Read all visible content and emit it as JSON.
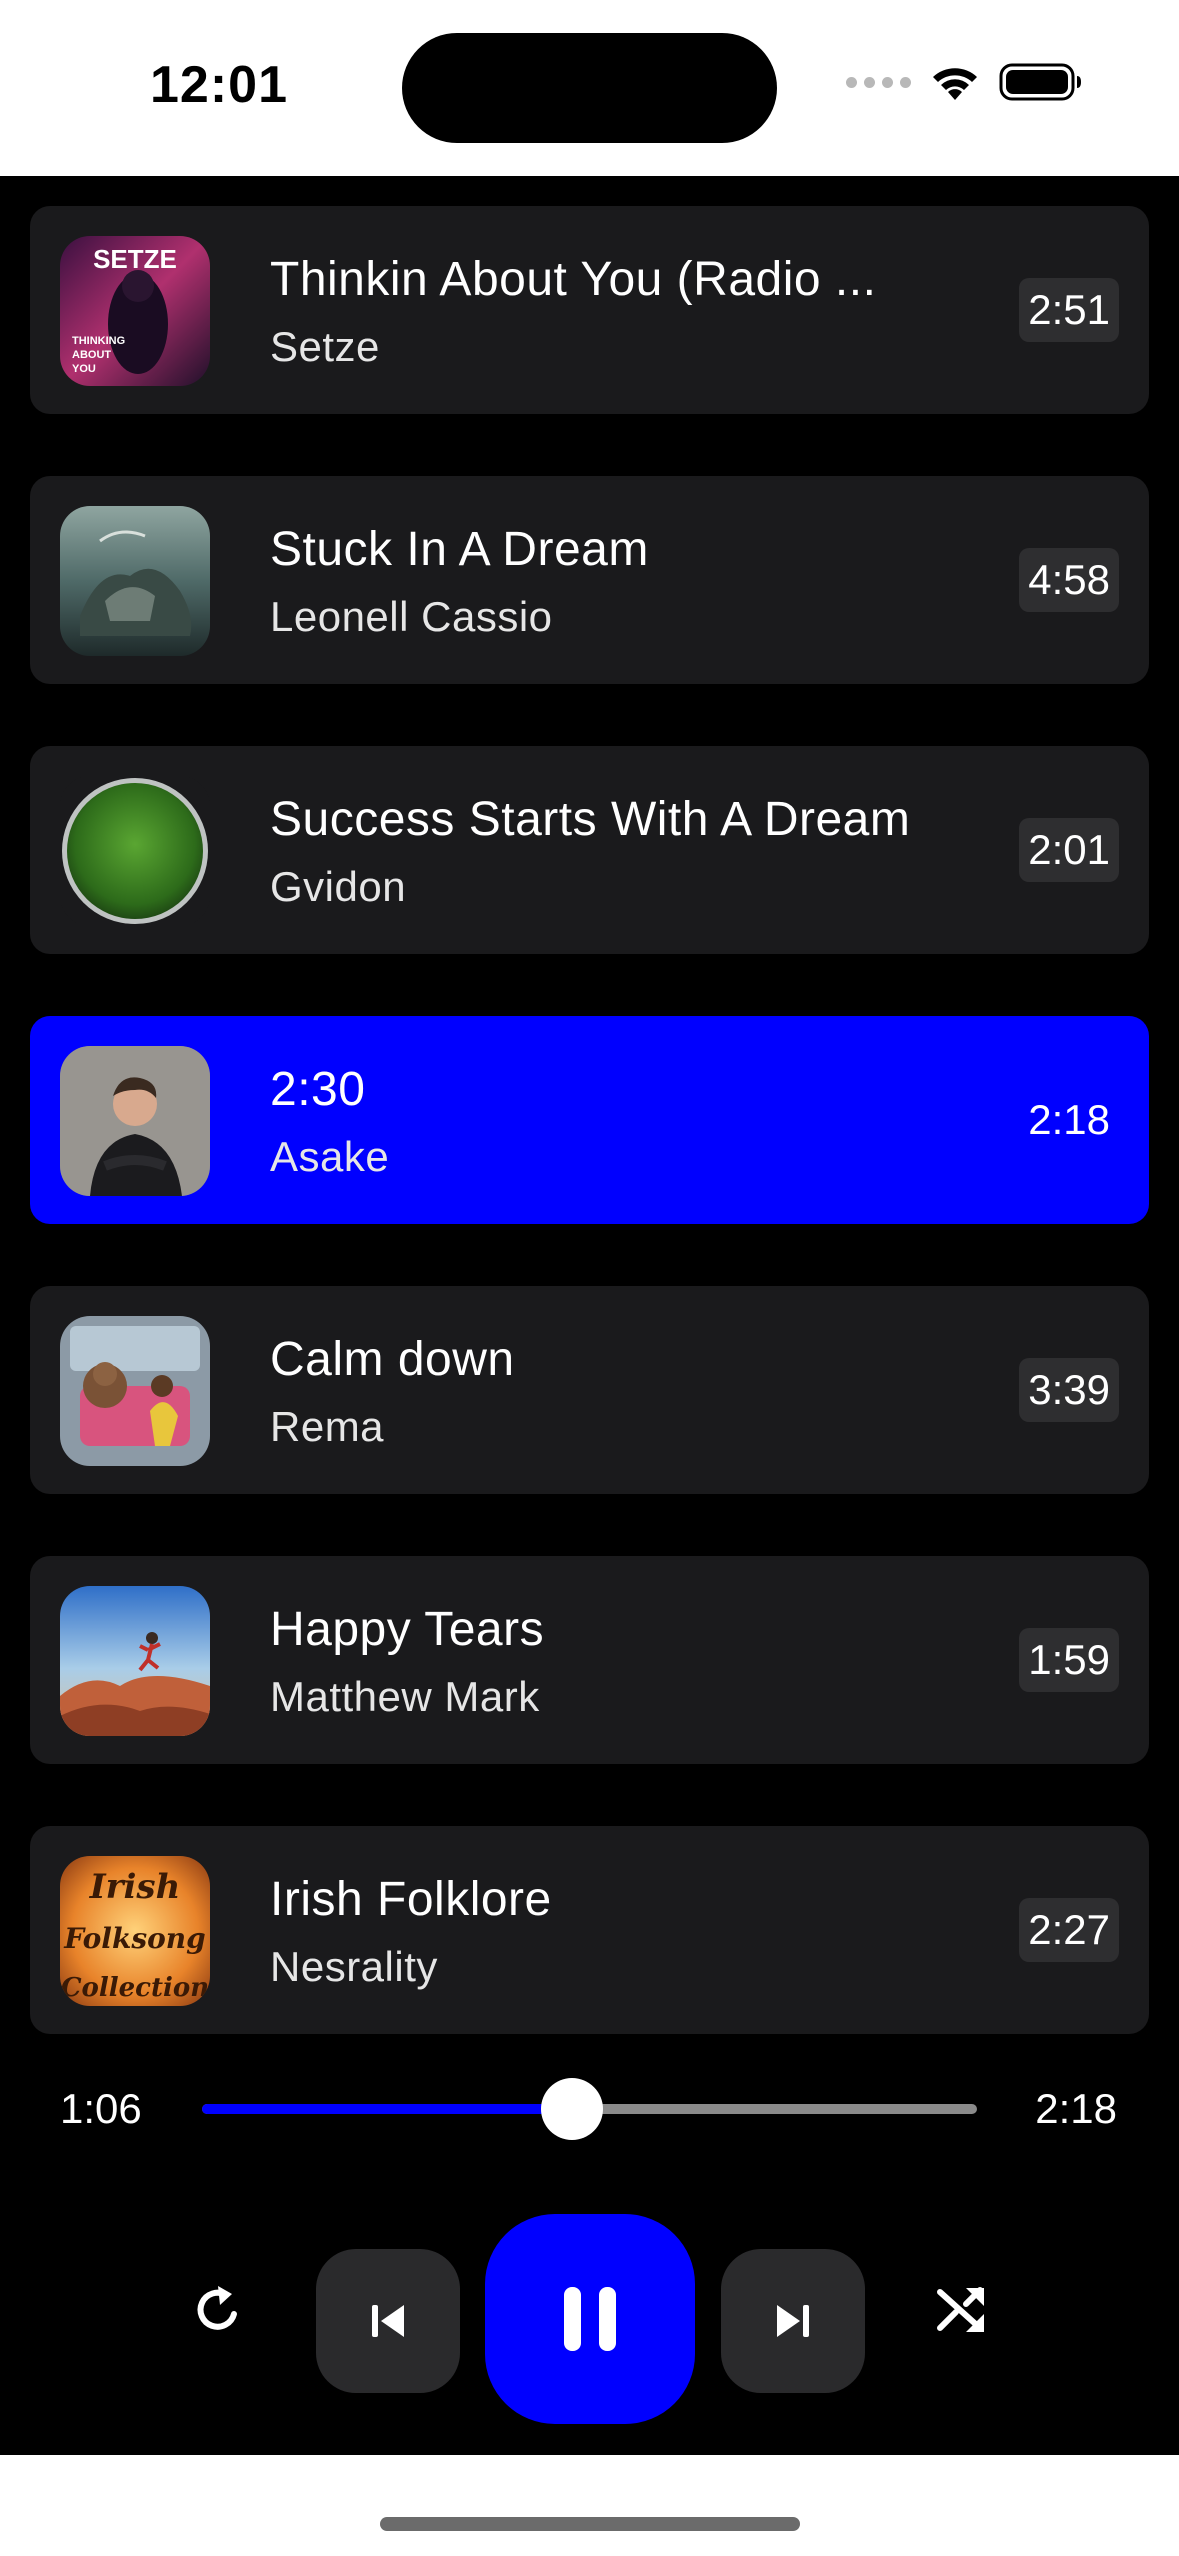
{
  "status_bar": {
    "time": "12:01"
  },
  "tracks": [
    {
      "title": "Thinkin About You (Radio ...",
      "artist": "Setze",
      "duration": "2:51",
      "active": false,
      "art": "setze-cover"
    },
    {
      "title": "Stuck In A Dream",
      "artist": "Leonell Cassio",
      "duration": "4:58",
      "active": false,
      "art": "dream-cover"
    },
    {
      "title": "Success Starts With A Dream",
      "artist": "Gvidon",
      "duration": "2:01",
      "active": false,
      "art": "moss-cover"
    },
    {
      "title": "2:30",
      "artist": "Asake",
      "duration": "2:18",
      "active": true,
      "art": "portrait-cover"
    },
    {
      "title": "Calm down",
      "artist": "Rema",
      "duration": "3:39",
      "active": false,
      "art": "train-cover"
    },
    {
      "title": "Happy Tears",
      "artist": "Matthew Mark",
      "duration": "1:59",
      "active": false,
      "art": "desert-cover"
    },
    {
      "title": "Irish Folklore",
      "artist": "Nesrality",
      "duration": "2:27",
      "active": false,
      "art": "irish-cover"
    }
  ],
  "cover_text": {
    "setze_logo": "SETZE",
    "setze_lines": [
      "THINKING",
      "ABOUT",
      "YOU"
    ],
    "irish_lines": [
      "Irish",
      "Folksong",
      "Collection"
    ]
  },
  "player": {
    "elapsed": "1:06",
    "total": "2:18",
    "progress": 0.478
  },
  "controls": {
    "repeat_icon": "repeat-icon",
    "prev_icon": "skip-previous-icon",
    "play_pause_icon": "pause-icon",
    "next_icon": "skip-next-icon",
    "shuffle_icon": "shuffle-icon"
  },
  "colors": {
    "accent": "#0000ff",
    "card": "#1a1a1c",
    "background": "#000000"
  }
}
